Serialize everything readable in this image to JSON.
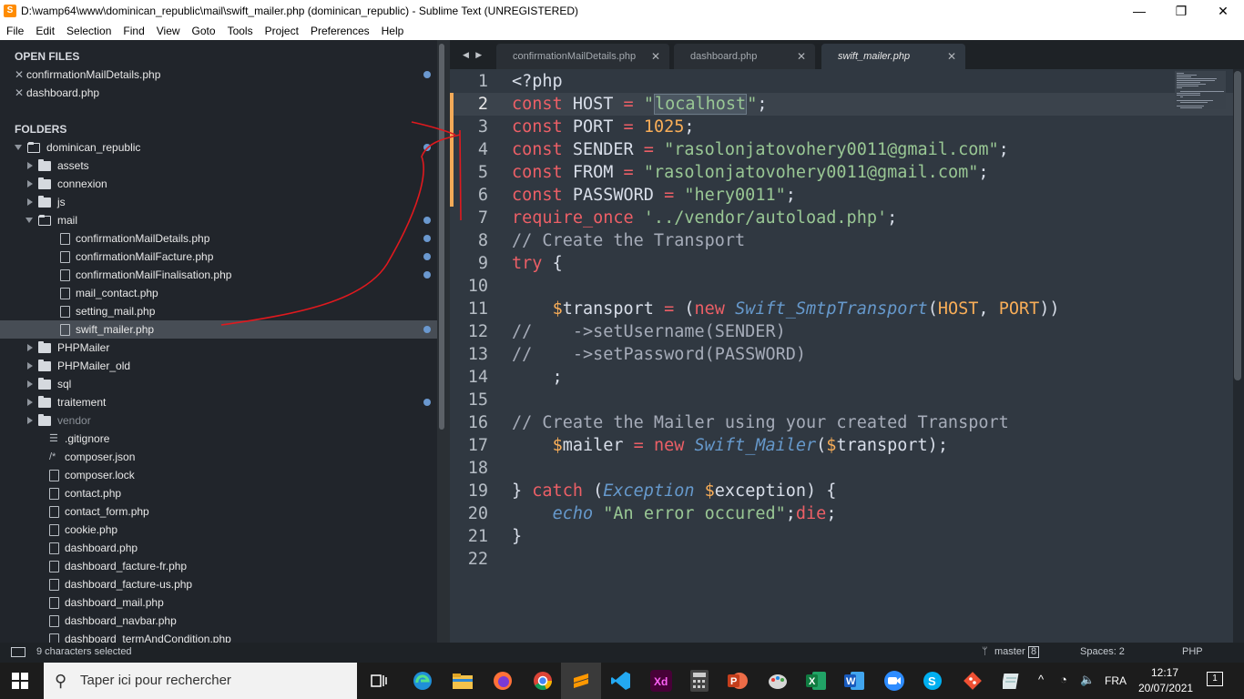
{
  "window": {
    "title": "D:\\wamp64\\www\\dominican_republic\\mail\\swift_mailer.php (dominican_republic) - Sublime Text (UNREGISTERED)",
    "minimize": "—",
    "maximize": "❐",
    "close": "✕"
  },
  "menu": [
    "File",
    "Edit",
    "Selection",
    "Find",
    "View",
    "Goto",
    "Tools",
    "Project",
    "Preferences",
    "Help"
  ],
  "sidebar": {
    "open_files_header": "OPEN FILES",
    "open_files": [
      "confirmationMailDetails.php",
      "dashboard.php"
    ],
    "folders_header": "FOLDERS",
    "tree": [
      {
        "label": "dominican_republic",
        "kind": "folder-open",
        "depth": 0,
        "dot": true
      },
      {
        "label": "assets",
        "kind": "folder",
        "depth": 1
      },
      {
        "label": "connexion",
        "kind": "folder",
        "depth": 1
      },
      {
        "label": "js",
        "kind": "folder",
        "depth": 1
      },
      {
        "label": "mail",
        "kind": "folder-open",
        "depth": 1,
        "dot": true
      },
      {
        "label": "confirmationMailDetails.php",
        "kind": "file",
        "depth": 2,
        "dot": true
      },
      {
        "label": "confirmationMailFacture.php",
        "kind": "file",
        "depth": 2,
        "dot": true
      },
      {
        "label": "confirmationMailFinalisation.php",
        "kind": "file",
        "depth": 2,
        "dot": true
      },
      {
        "label": "mail_contact.php",
        "kind": "file",
        "depth": 2
      },
      {
        "label": "setting_mail.php",
        "kind": "file",
        "depth": 2
      },
      {
        "label": "swift_mailer.php",
        "kind": "file",
        "depth": 2,
        "dot": true,
        "selected": true
      },
      {
        "label": "PHPMailer",
        "kind": "folder",
        "depth": 1
      },
      {
        "label": "PHPMailer_old",
        "kind": "folder",
        "depth": 1
      },
      {
        "label": "sql",
        "kind": "folder",
        "depth": 1
      },
      {
        "label": "traitement",
        "kind": "folder",
        "depth": 1,
        "dot": true
      },
      {
        "label": "vendor",
        "kind": "folder",
        "depth": 1,
        "dim": true
      },
      {
        "label": ".gitignore",
        "kind": "lines",
        "depth": 1
      },
      {
        "label": "composer.json",
        "kind": "code",
        "depth": 1
      },
      {
        "label": "composer.lock",
        "kind": "file",
        "depth": 1
      },
      {
        "label": "contact.php",
        "kind": "file",
        "depth": 1
      },
      {
        "label": "contact_form.php",
        "kind": "file",
        "depth": 1
      },
      {
        "label": "cookie.php",
        "kind": "file",
        "depth": 1
      },
      {
        "label": "dashboard.php",
        "kind": "file",
        "depth": 1
      },
      {
        "label": "dashboard_facture-fr.php",
        "kind": "file",
        "depth": 1
      },
      {
        "label": "dashboard_facture-us.php",
        "kind": "file",
        "depth": 1
      },
      {
        "label": "dashboard_mail.php",
        "kind": "file",
        "depth": 1
      },
      {
        "label": "dashboard_navbar.php",
        "kind": "file",
        "depth": 1
      },
      {
        "label": "dashboard_termAndCondition.php",
        "kind": "file",
        "depth": 1
      }
    ]
  },
  "tabs": {
    "nav_left": "◀",
    "nav_right": "▶",
    "items": [
      {
        "label": "confirmationMailDetails.php",
        "close": "✕"
      },
      {
        "label": "dashboard.php",
        "close": "✕"
      },
      {
        "label": "swift_mailer.php",
        "close": "✕",
        "active": true
      }
    ]
  },
  "editor": {
    "line_numbers": [
      "1",
      "2",
      "3",
      "4",
      "5",
      "6",
      "7",
      "8",
      "9",
      "10",
      "11",
      "12",
      "13",
      "14",
      "15",
      "16",
      "17",
      "18",
      "19",
      "20",
      "21",
      "22"
    ],
    "current_line": 2,
    "lines": [
      [
        [
          "plain",
          "<?php"
        ]
      ],
      [
        [
          "kw",
          "const "
        ],
        [
          "plain",
          "HOST "
        ],
        [
          "kw",
          "= "
        ],
        [
          "str",
          "\""
        ],
        [
          "sel",
          "localhost"
        ],
        [
          "str",
          "\""
        ],
        [
          "plain",
          ";"
        ]
      ],
      [
        [
          "kw",
          "const "
        ],
        [
          "plain",
          "PORT "
        ],
        [
          "kw",
          "= "
        ],
        [
          "num",
          "1025"
        ],
        [
          "plain",
          ";"
        ]
      ],
      [
        [
          "kw",
          "const "
        ],
        [
          "plain",
          "SENDER "
        ],
        [
          "kw",
          "= "
        ],
        [
          "str",
          "\"rasolonjatovohery0011@gmail.com\""
        ],
        [
          "plain",
          ";"
        ]
      ],
      [
        [
          "kw",
          "const "
        ],
        [
          "plain",
          "FROM "
        ],
        [
          "kw",
          "= "
        ],
        [
          "str",
          "\"rasolonjatovohery0011@gmail.com\""
        ],
        [
          "plain",
          ";"
        ]
      ],
      [
        [
          "kw",
          "const "
        ],
        [
          "plain",
          "PASSWORD "
        ],
        [
          "kw",
          "= "
        ],
        [
          "str",
          "\"hery0011\""
        ],
        [
          "plain",
          ";"
        ]
      ],
      [
        [
          "kw",
          "require_once "
        ],
        [
          "str",
          "'../vendor/autoload.php'"
        ],
        [
          "plain",
          ";"
        ]
      ],
      [
        [
          "cmt",
          "// Create the Transport"
        ]
      ],
      [
        [
          "kw",
          "try "
        ],
        [
          "plain",
          "{"
        ]
      ],
      [
        [
          "plain",
          ""
        ]
      ],
      [
        [
          "plain",
          "    "
        ],
        [
          "var",
          "$"
        ],
        [
          "plain",
          "transport "
        ],
        [
          "kw",
          "= "
        ],
        [
          "plain",
          "("
        ],
        [
          "kw",
          "new "
        ],
        [
          "fn",
          "Swift_SmtpTransport"
        ],
        [
          "plain",
          "("
        ],
        [
          "var",
          "HOST"
        ],
        [
          "plain",
          ", "
        ],
        [
          "var",
          "PORT"
        ],
        [
          "plain",
          "))"
        ]
      ],
      [
        [
          "cmt",
          "//    ->setUsername(SENDER)"
        ]
      ],
      [
        [
          "cmt",
          "//    ->setPassword(PASSWORD)"
        ]
      ],
      [
        [
          "plain",
          "    ;"
        ]
      ],
      [
        [
          "plain",
          ""
        ]
      ],
      [
        [
          "cmt",
          "// Create the Mailer using your created Transport"
        ]
      ],
      [
        [
          "plain",
          "    "
        ],
        [
          "var",
          "$"
        ],
        [
          "plain",
          "mailer "
        ],
        [
          "kw",
          "= new "
        ],
        [
          "fn",
          "Swift_Mailer"
        ],
        [
          "plain",
          "("
        ],
        [
          "var",
          "$"
        ],
        [
          "plain",
          "transport);"
        ]
      ],
      [
        [
          "plain",
          ""
        ]
      ],
      [
        [
          "plain",
          "} "
        ],
        [
          "kw",
          "catch "
        ],
        [
          "plain",
          "("
        ],
        [
          "fn",
          "Exception "
        ],
        [
          "var",
          "$"
        ],
        [
          "plain",
          "exception) {"
        ]
      ],
      [
        [
          "plain",
          "    "
        ],
        [
          "fn",
          "echo "
        ],
        [
          "str",
          "\"An error occured\""
        ],
        [
          "plain",
          ";"
        ],
        [
          "kw",
          "die"
        ],
        [
          "plain",
          ";"
        ]
      ],
      [
        [
          "plain",
          "}"
        ]
      ],
      [
        [
          "plain",
          ""
        ]
      ]
    ]
  },
  "status": {
    "selection": "9 characters selected",
    "branch": "master",
    "branch_count": "8",
    "spaces": "Spaces: 2",
    "syntax": "PHP"
  },
  "taskbar": {
    "search_placeholder": "Taper ici pour rechercher",
    "apps": [
      "task-view",
      "edge",
      "file-explorer",
      "firefox",
      "chrome",
      "sublime-text",
      "vscode",
      "adobe-xd",
      "calculator",
      "powerpoint",
      "paint",
      "excel",
      "word",
      "zoom",
      "skype",
      "git",
      "notepad"
    ],
    "language": "FRA",
    "time": "12:17",
    "date": "20/07/2021",
    "notifications": "1"
  },
  "colors": {
    "accent": "#f9ae58",
    "modified_dot": "#6a98cf",
    "annotation": "#e0191e"
  }
}
